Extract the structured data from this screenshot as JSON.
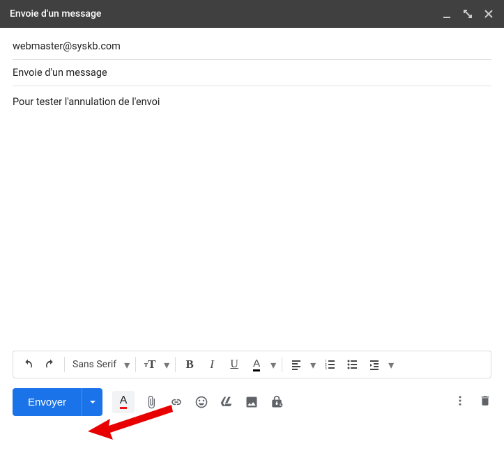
{
  "header": {
    "title": "Envoie d'un message"
  },
  "compose": {
    "to": "webmaster@syskb.com",
    "subject": "Envoie d'un message",
    "body": "Pour tester l'annulation de l'envoi"
  },
  "format": {
    "font_family": "Sans Serif"
  },
  "actions": {
    "send_label": "Envoyer"
  }
}
